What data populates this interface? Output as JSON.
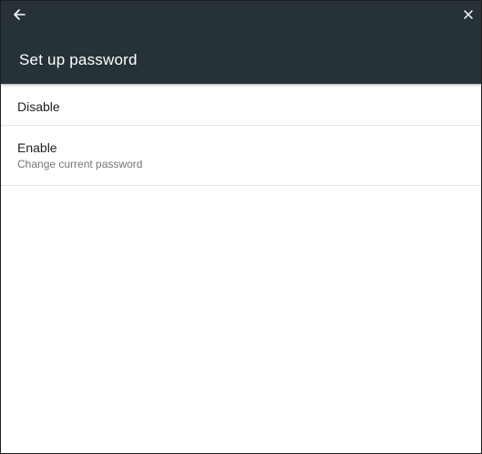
{
  "appbar": {
    "title": "Set up password",
    "back_icon": "arrow-left-icon",
    "close_icon": "close-icon",
    "background": "#263238"
  },
  "options": [
    {
      "title": "Disable",
      "subtitle": ""
    },
    {
      "title": "Enable",
      "subtitle": "Change current password"
    }
  ]
}
